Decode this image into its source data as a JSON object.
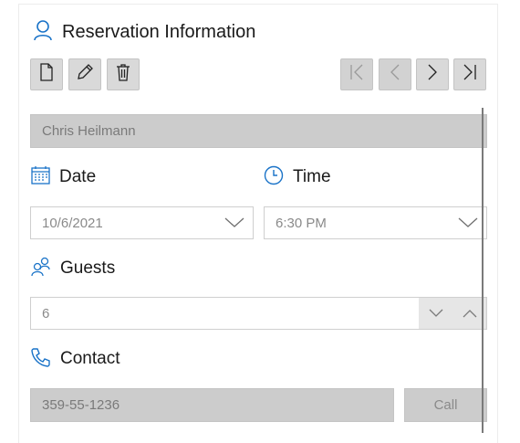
{
  "header": {
    "title": "Reservation Information"
  },
  "toolbar": {
    "new_icon": "document-icon",
    "edit_icon": "pencil-icon",
    "delete_icon": "trash-icon",
    "first_icon": "first-record-icon",
    "prev_icon": "previous-record-icon",
    "next_icon": "next-record-icon",
    "last_icon": "last-record-icon"
  },
  "name": {
    "value": "Chris Heilmann"
  },
  "date": {
    "label": "Date",
    "value": "10/6/2021"
  },
  "time": {
    "label": "Time",
    "value": "6:30 PM"
  },
  "guests": {
    "label": "Guests",
    "value": "6"
  },
  "contact": {
    "label": "Contact",
    "value": "359-55-1236",
    "call_label": "Call"
  },
  "colors": {
    "accent": "#1a73c8",
    "disabled_bg": "#cccccc",
    "button_bg": "#d9d9d9"
  }
}
